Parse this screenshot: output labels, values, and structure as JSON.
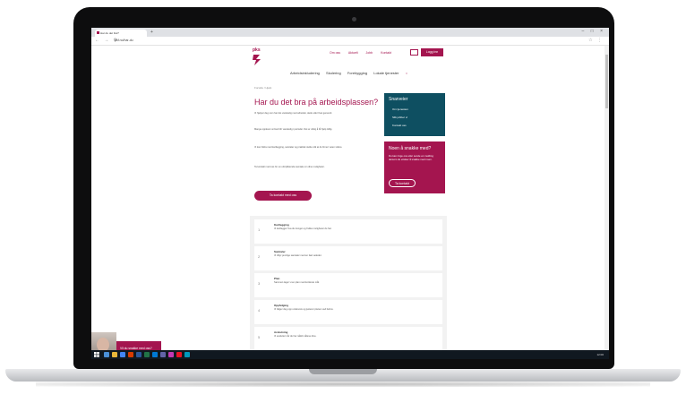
{
  "browser": {
    "tab_title": "Har du det bra?",
    "new_tab_glyph": "+",
    "window_controls": "– □ ×",
    "nav_glyphs": "← → ⟳",
    "url": "pkf.no/har-du",
    "addr_right_glyphs": "☆ ⋮"
  },
  "site": {
    "logo_text": "pks",
    "brand_color": "#a4154f",
    "teal_color": "#0e4f61",
    "top_links": [
      "Om oss",
      "Aktuelt",
      "Jobb",
      "Kontakt"
    ],
    "login_label": "Logg inn",
    "main_nav": [
      "Arbeidsinkludering",
      "Skolering",
      "Forebygging",
      "Lokale tjenester"
    ]
  },
  "main": {
    "breadcrumb": "Forside / Hjelp",
    "title": "Har du det bra på arbeidsplassen?",
    "paragraphs": [
      "Vi hjelper deg som har det vanskelig med arbeidet, skole eller livet generelt.",
      "Mange opplever at livet blir vanskelig i perioder. Det er viktig å få hjelp tidlig.",
      "Vi kan bidra med kartlegging, samtaler og praktisk støtte slik at du finner veien videre.",
      "Ta kontakt med oss for en uforpliktende samtale om dine muligheter."
    ],
    "cta_label": "Ta kontakt med oss"
  },
  "sidebar": {
    "teal_title": "Snarveier",
    "teal_items": [
      "Om tjenesten",
      "Slik jobber vi",
      "Kontakt oss"
    ],
    "pink_title": "Noen å snakke med?",
    "pink_text": "Du kan ringe oss eller sende en melding dersom du ønsker å snakke med noen.",
    "pink_button": "Ta kontakt"
  },
  "steps": [
    {
      "num": "1",
      "title": "Kartlegging",
      "text": "Vi kartlegger hva du trenger og hvilke muligheter du har."
    },
    {
      "num": "2",
      "title": "Samtaler",
      "text": "Vi tilbyr jevnlige samtaler med en fast veileder."
    },
    {
      "num": "3",
      "title": "Plan",
      "text": "Sammen lager vi en plan med konkrete mål."
    },
    {
      "num": "4",
      "title": "Oppfølging",
      "text": "Vi følger deg opp underveis og justerer planen ved behov."
    },
    {
      "num": "5",
      "title": "Avslutning",
      "text": "Vi avslutter når du har nådd målene dine."
    }
  ],
  "chat": {
    "text": "Vil du snakke med oss?"
  },
  "taskbar": {
    "tray_text": "12:00"
  }
}
